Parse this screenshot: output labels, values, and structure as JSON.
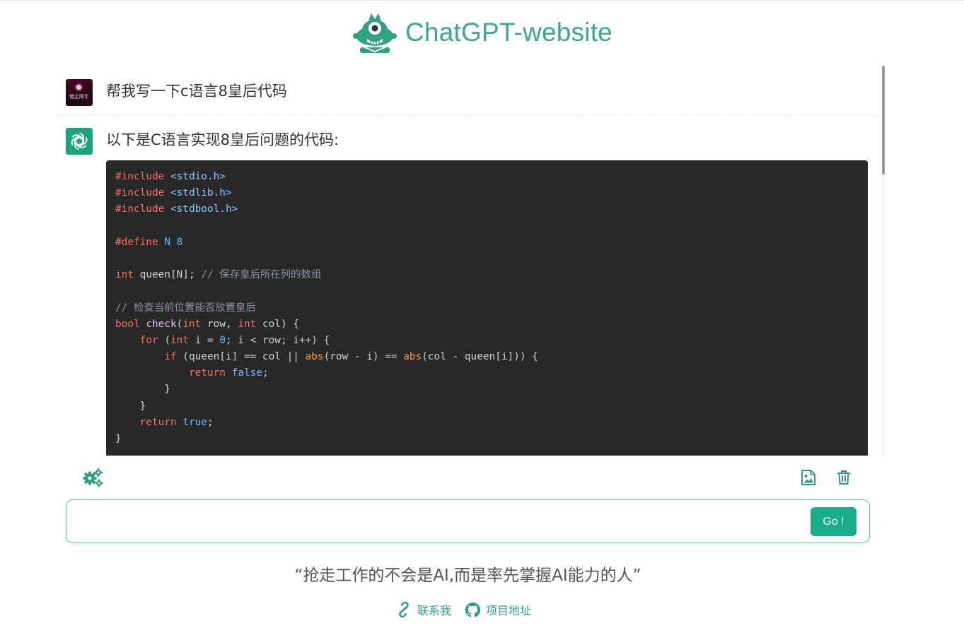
{
  "header": {
    "title": "ChatGPT-website",
    "logo_icon": "mascot-logo-icon"
  },
  "colors": {
    "accent": "#3aa98c",
    "button": "#19ad8a",
    "code_bg": "#282828"
  },
  "messages": {
    "user": {
      "avatar_icon": "user-avatar",
      "avatar_label": "馆主阿牛",
      "text": "帮我写一下c语言8皇后代码"
    },
    "bot": {
      "avatar_icon": "openai-logo-icon",
      "text": "以下是C语言实现8皇后问题的代码:",
      "code": {
        "language": "c",
        "lines": [
          [
            [
              "kw",
              "#include "
            ],
            [
              "str",
              "<stdio.h>"
            ]
          ],
          [
            [
              "kw",
              "#include "
            ],
            [
              "str",
              "<stdlib.h>"
            ]
          ],
          [
            [
              "kw",
              "#include "
            ],
            [
              "str",
              "<stdbool.h>"
            ]
          ],
          [],
          [
            [
              "kw",
              "#define "
            ],
            [
              "num",
              "N 8"
            ]
          ],
          [],
          [
            [
              "kw",
              "int"
            ],
            [
              "plain",
              " queen[N]; "
            ],
            [
              "com",
              "// 保存皇后所在列的数组"
            ]
          ],
          [],
          [
            [
              "com",
              "// 检查当前位置能否放置皇后"
            ]
          ],
          [
            [
              "kw",
              "bool "
            ],
            [
              "fn",
              "check"
            ],
            [
              "plain",
              "("
            ],
            [
              "kw",
              "int"
            ],
            [
              "plain",
              " row, "
            ],
            [
              "kw",
              "int"
            ],
            [
              "plain",
              " col) {"
            ]
          ],
          [
            [
              "plain",
              "    "
            ],
            [
              "kw",
              "for"
            ],
            [
              "plain",
              " ("
            ],
            [
              "kw",
              "int"
            ],
            [
              "plain",
              " i = "
            ],
            [
              "num",
              "0"
            ],
            [
              "plain",
              "; i < row; i++) {"
            ]
          ],
          [
            [
              "plain",
              "        "
            ],
            [
              "kw",
              "if"
            ],
            [
              "plain",
              " (queen[i] == col || "
            ],
            [
              "builtin",
              "abs"
            ],
            [
              "plain",
              "(row - i) == "
            ],
            [
              "builtin",
              "abs"
            ],
            [
              "plain",
              "(col - queen[i])) {"
            ]
          ],
          [
            [
              "plain",
              "            "
            ],
            [
              "kw",
              "return "
            ],
            [
              "lit",
              "false"
            ],
            [
              "plain",
              ";"
            ]
          ],
          [
            [
              "plain",
              "        }"
            ]
          ],
          [
            [
              "plain",
              "    }"
            ]
          ],
          [
            [
              "plain",
              "    "
            ],
            [
              "kw",
              "return "
            ],
            [
              "lit",
              "true"
            ],
            [
              "plain",
              ";"
            ]
          ],
          [
            [
              "plain",
              "}"
            ]
          ]
        ]
      }
    }
  },
  "toolbar": {
    "settings_icon": "gears-icon",
    "export_image_icon": "image-icon",
    "clear_icon": "trash-icon"
  },
  "input": {
    "value": "",
    "placeholder": "",
    "send_label": "Go !"
  },
  "quote": "“抢走工作的不会是AI,而是率先掌握AI能力的人”",
  "footer": {
    "contact_label": "联系我",
    "contact_icon": "link-icon",
    "repo_label": "项目地址",
    "repo_icon": "github-icon"
  }
}
